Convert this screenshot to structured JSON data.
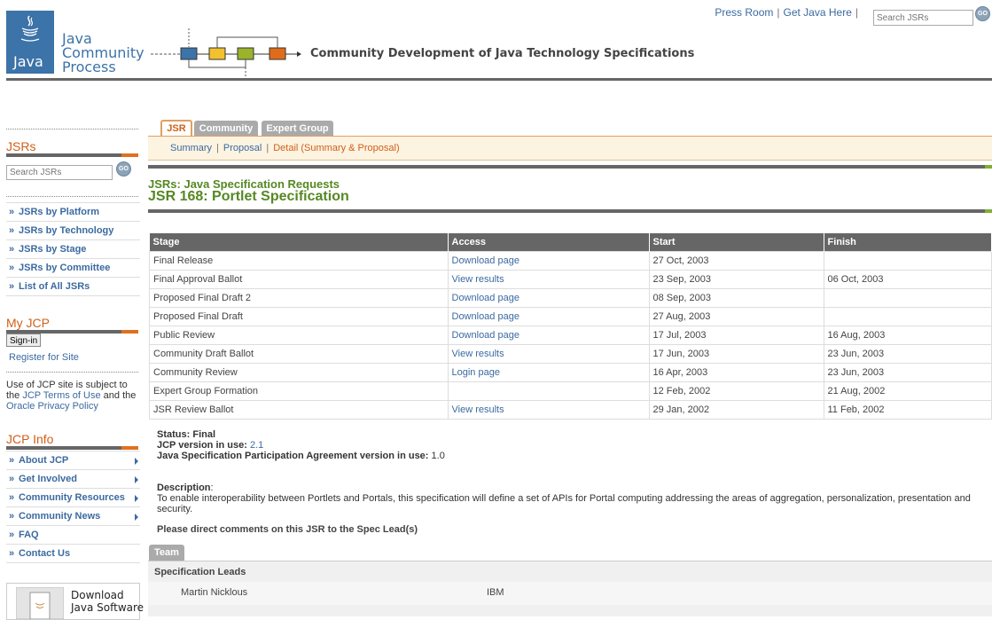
{
  "header": {
    "logo_word": "Java",
    "logo_lines": [
      "Java",
      "Community",
      "Process"
    ],
    "tagline": "Community Development of Java Technology Specifications",
    "toplinks": [
      "Press Room",
      "Get Java Here"
    ],
    "search_placeholder": "Search JSRs",
    "go": "GO",
    "diagram_colors": [
      "#3c73a8",
      "#f2c12e",
      "#9ab32a",
      "#e06c1a"
    ]
  },
  "sidebar": {
    "jsrs_title": "JSRs",
    "search_placeholder": "Search JSRs",
    "go": "GO",
    "jsr_links": [
      "JSRs by Platform",
      "JSRs by Technology",
      "JSRs by Stage",
      "JSRs by Committee",
      "List of All JSRs"
    ],
    "myjcp_title": "My JCP",
    "signin": "Sign-in",
    "register": "Register for Site",
    "terms_prefix": "Use of JCP site is subject to the",
    "terms_link": "JCP Terms of Use",
    "terms_and": "and the",
    "privacy_link": "Oracle Privacy Policy",
    "jcpinfo_title": "JCP Info",
    "info_links": [
      {
        "label": "About JCP",
        "arrow": true
      },
      {
        "label": "Get Involved",
        "arrow": true
      },
      {
        "label": "Community Resources",
        "arrow": true
      },
      {
        "label": "Community News",
        "arrow": true
      },
      {
        "label": "FAQ",
        "arrow": false
      },
      {
        "label": "Contact Us",
        "arrow": false
      }
    ],
    "download": [
      "Download",
      "Java Software"
    ]
  },
  "tabs": [
    "JSR",
    "Community",
    "Expert Group"
  ],
  "subnav": {
    "summary": "Summary",
    "proposal": "Proposal",
    "detail": "Detail (Summary & Proposal)"
  },
  "title": {
    "sup": "JSRs: Java Specification Requests",
    "main": "JSR 168: Portlet Specification"
  },
  "stages": {
    "headers": [
      "Stage",
      "Access",
      "Start",
      "Finish"
    ],
    "rows": [
      [
        "Final Release",
        "Download page",
        "27 Oct, 2003",
        ""
      ],
      [
        "Final Approval Ballot",
        "View results",
        "23 Sep, 2003",
        "06 Oct, 2003"
      ],
      [
        "Proposed Final Draft 2",
        "Download page",
        "08 Sep, 2003",
        ""
      ],
      [
        "Proposed Final Draft",
        "Download page",
        "27 Aug, 2003",
        ""
      ],
      [
        "Public Review",
        "Download page",
        "17 Jul, 2003",
        "16 Aug, 2003"
      ],
      [
        "Community Draft Ballot",
        "View results",
        "17 Jun, 2003",
        "23 Jun, 2003"
      ],
      [
        "Community Review",
        "Login page",
        "16 Apr, 2003",
        "23 Jun, 2003"
      ],
      [
        "Expert Group Formation",
        "",
        "12 Feb, 2002",
        "21 Aug, 2002"
      ],
      [
        "JSR Review Ballot",
        "View results",
        "29 Jan, 2002",
        "11 Feb, 2002"
      ]
    ]
  },
  "status": {
    "status_label": "Status:",
    "status_value": "Final",
    "jcp_label": "JCP version in use:",
    "jcp_value": "2.1",
    "jspa_label": "Java Specification Participation Agreement version in use:",
    "jspa_value": "1.0"
  },
  "description": {
    "label": "Description",
    "text": "To enable interoperability between Portlets and Portals, this specification will define a set of APIs for Portal computing addressing the areas of aggregation, personalization, presentation and security."
  },
  "direct": "Please direct comments on this JSR to the Spec Lead(s)",
  "team": {
    "tab": "Team",
    "heading": "Specification Leads",
    "lead_name": "Martin Nicklous",
    "lead_org": "IBM"
  }
}
